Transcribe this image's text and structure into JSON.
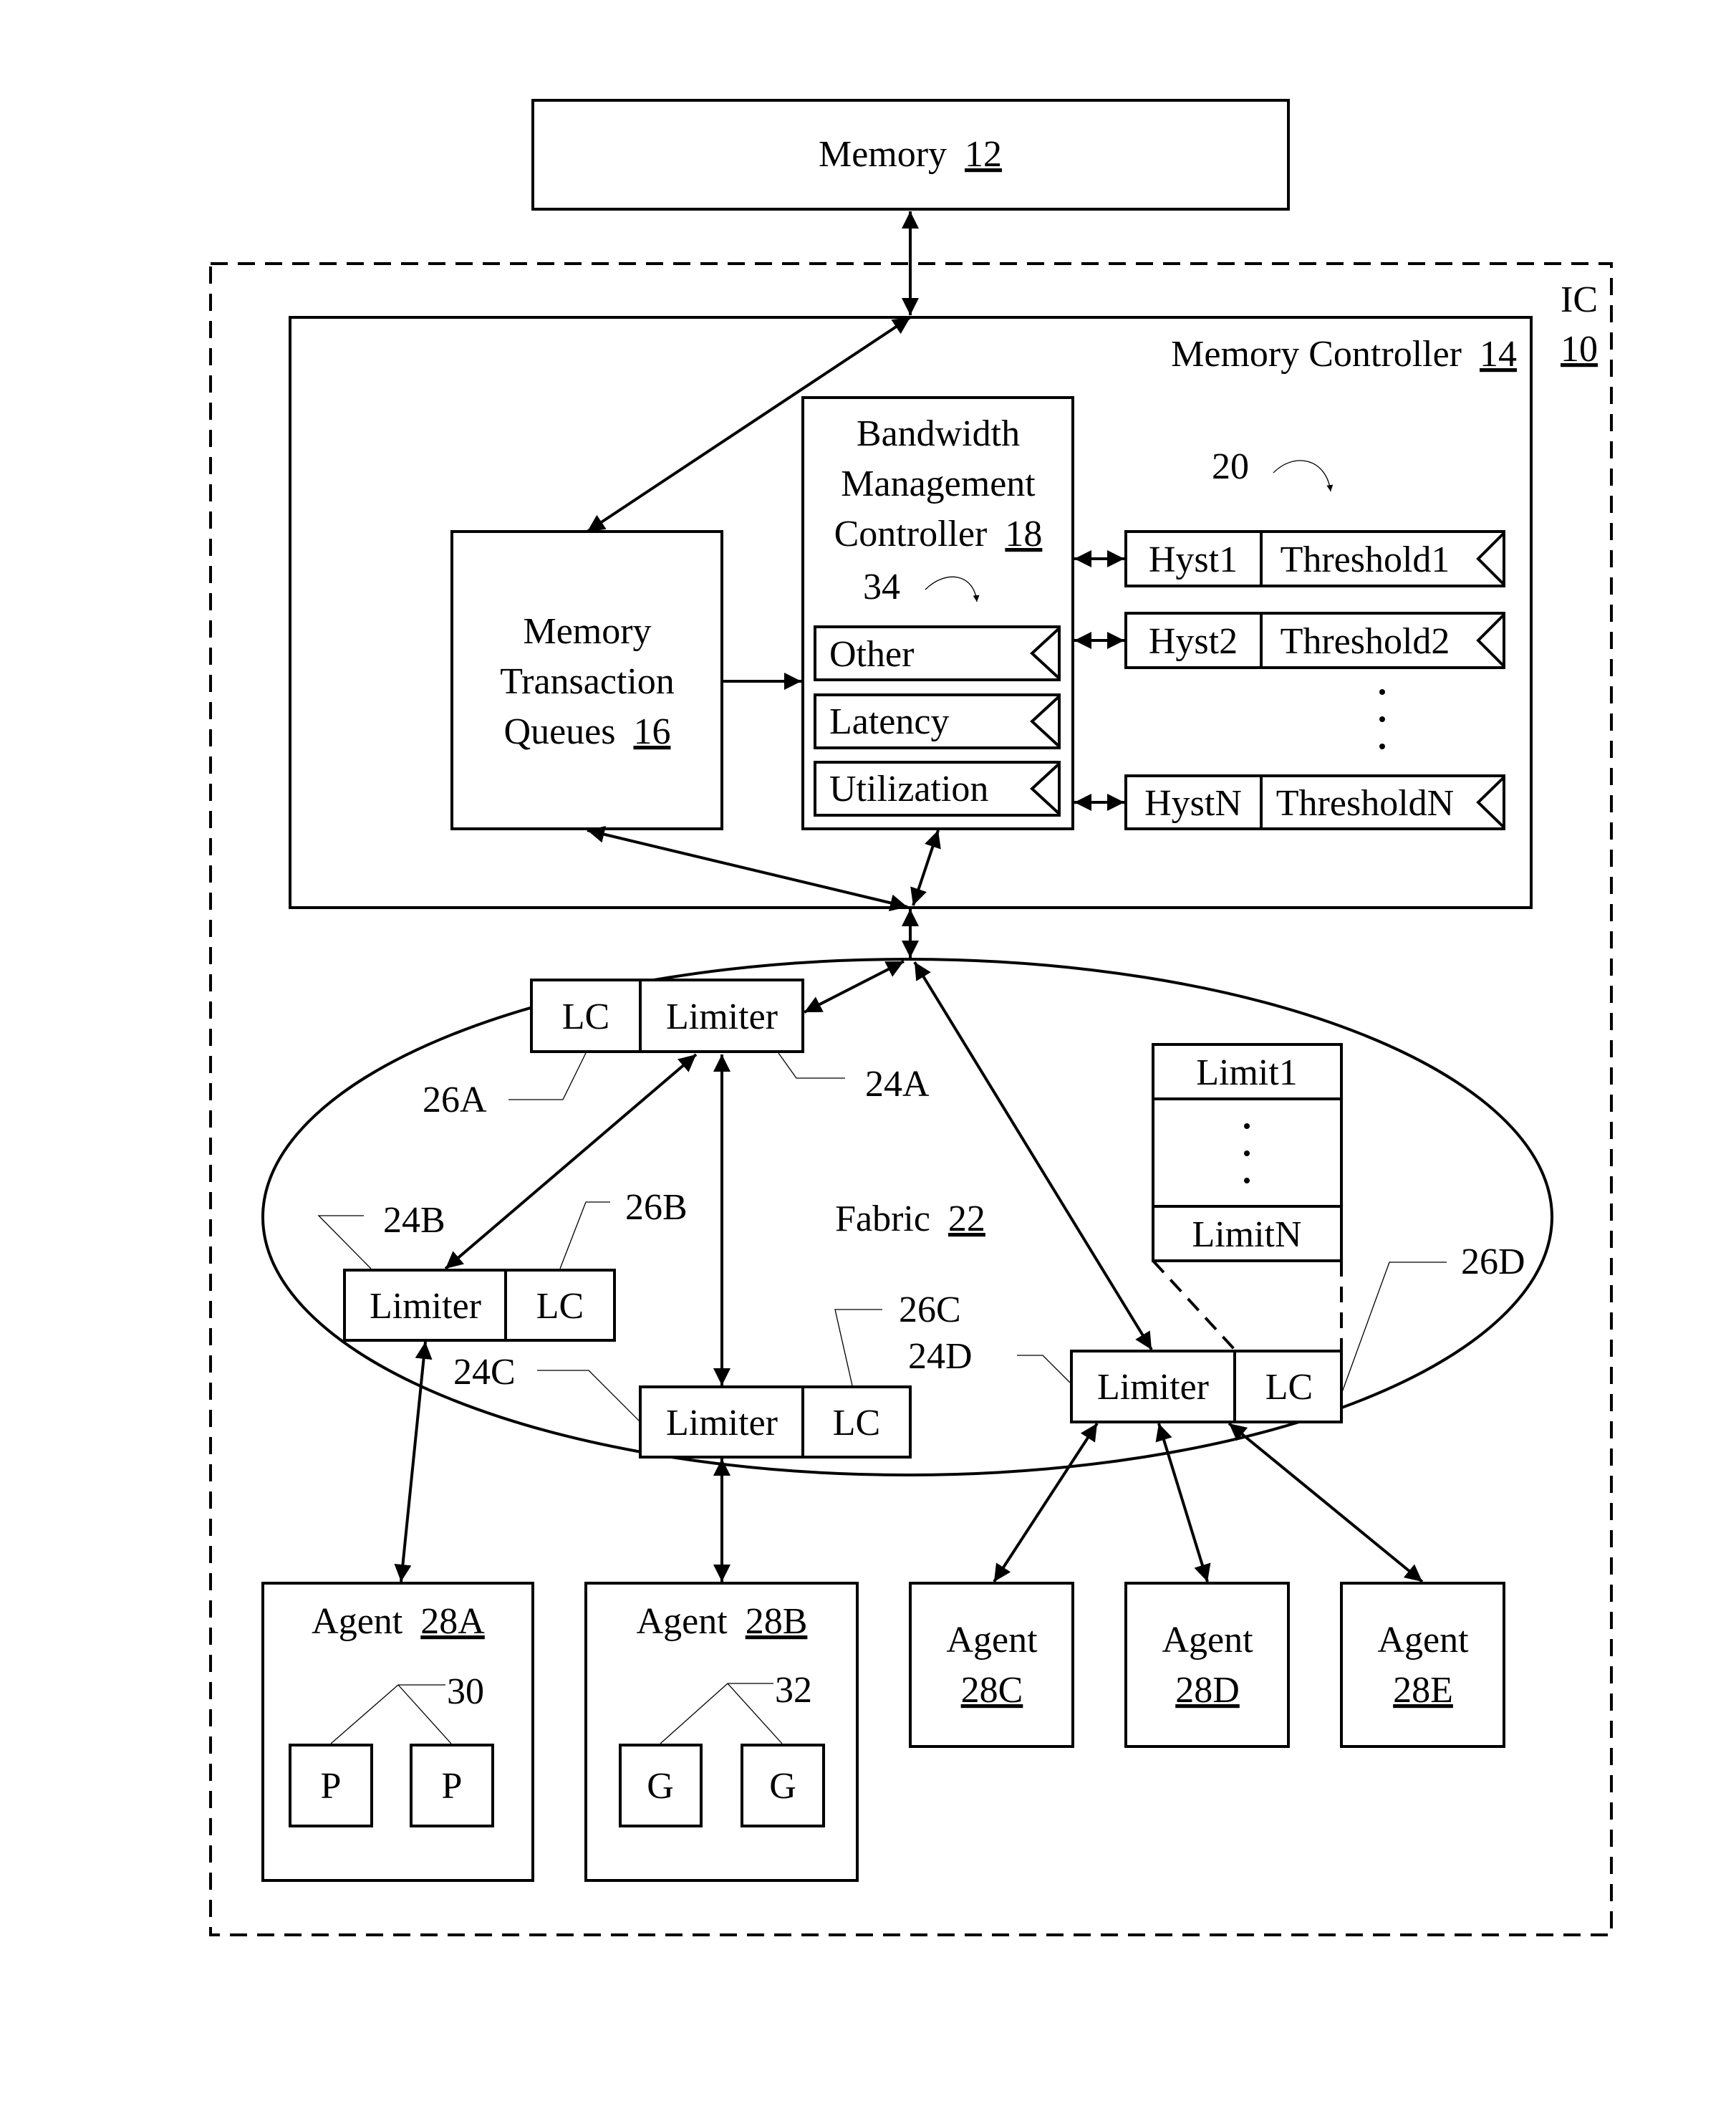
{
  "memory": {
    "name": "Memory",
    "ref": "12"
  },
  "ic": {
    "name": "IC",
    "ref": "10"
  },
  "memory_controller": {
    "name": "Memory Controller",
    "ref": "14"
  },
  "transaction_queues": {
    "line1": "Memory",
    "line2": "Transaction",
    "line3": "Queues",
    "ref": "16"
  },
  "bandwidth_controller": {
    "line1": "Bandwidth",
    "line2": "Management",
    "line3": "Controller",
    "ref": "18",
    "monitor_ref": "34",
    "monitors": [
      "Other",
      "Latency",
      "Utilization"
    ]
  },
  "threshold_table": {
    "ref": "20",
    "rows": [
      {
        "hyst": "Hyst1",
        "threshold": "Threshold1"
      },
      {
        "hyst": "Hyst2",
        "threshold": "Threshold2"
      },
      {
        "hyst": "HystN",
        "threshold": "ThresholdN"
      }
    ],
    "ellipsis": "⋮"
  },
  "fabric": {
    "name": "Fabric",
    "ref": "22"
  },
  "limiters": {
    "limiter_label": "Limiter",
    "lc_label": "LC",
    "refs": {
      "limiter_a": "24A",
      "lc_a": "26A",
      "limiter_b": "24B",
      "lc_b": "26B",
      "limiter_c": "24C",
      "lc_c": "26C",
      "limiter_d": "24D",
      "lc_d": "26D"
    }
  },
  "limit_table": {
    "first": "Limit1",
    "last": "LimitN"
  },
  "agents": {
    "a": {
      "name": "Agent",
      "ref": "28A",
      "sub_ref": "30",
      "sub_label": "P"
    },
    "b": {
      "name": "Agent",
      "ref": "28B",
      "sub_ref": "32",
      "sub_label": "G"
    },
    "c": {
      "name": "Agent",
      "ref": "28C"
    },
    "d": {
      "name": "Agent",
      "ref": "28D"
    },
    "e": {
      "name": "Agent",
      "ref": "28E"
    }
  }
}
